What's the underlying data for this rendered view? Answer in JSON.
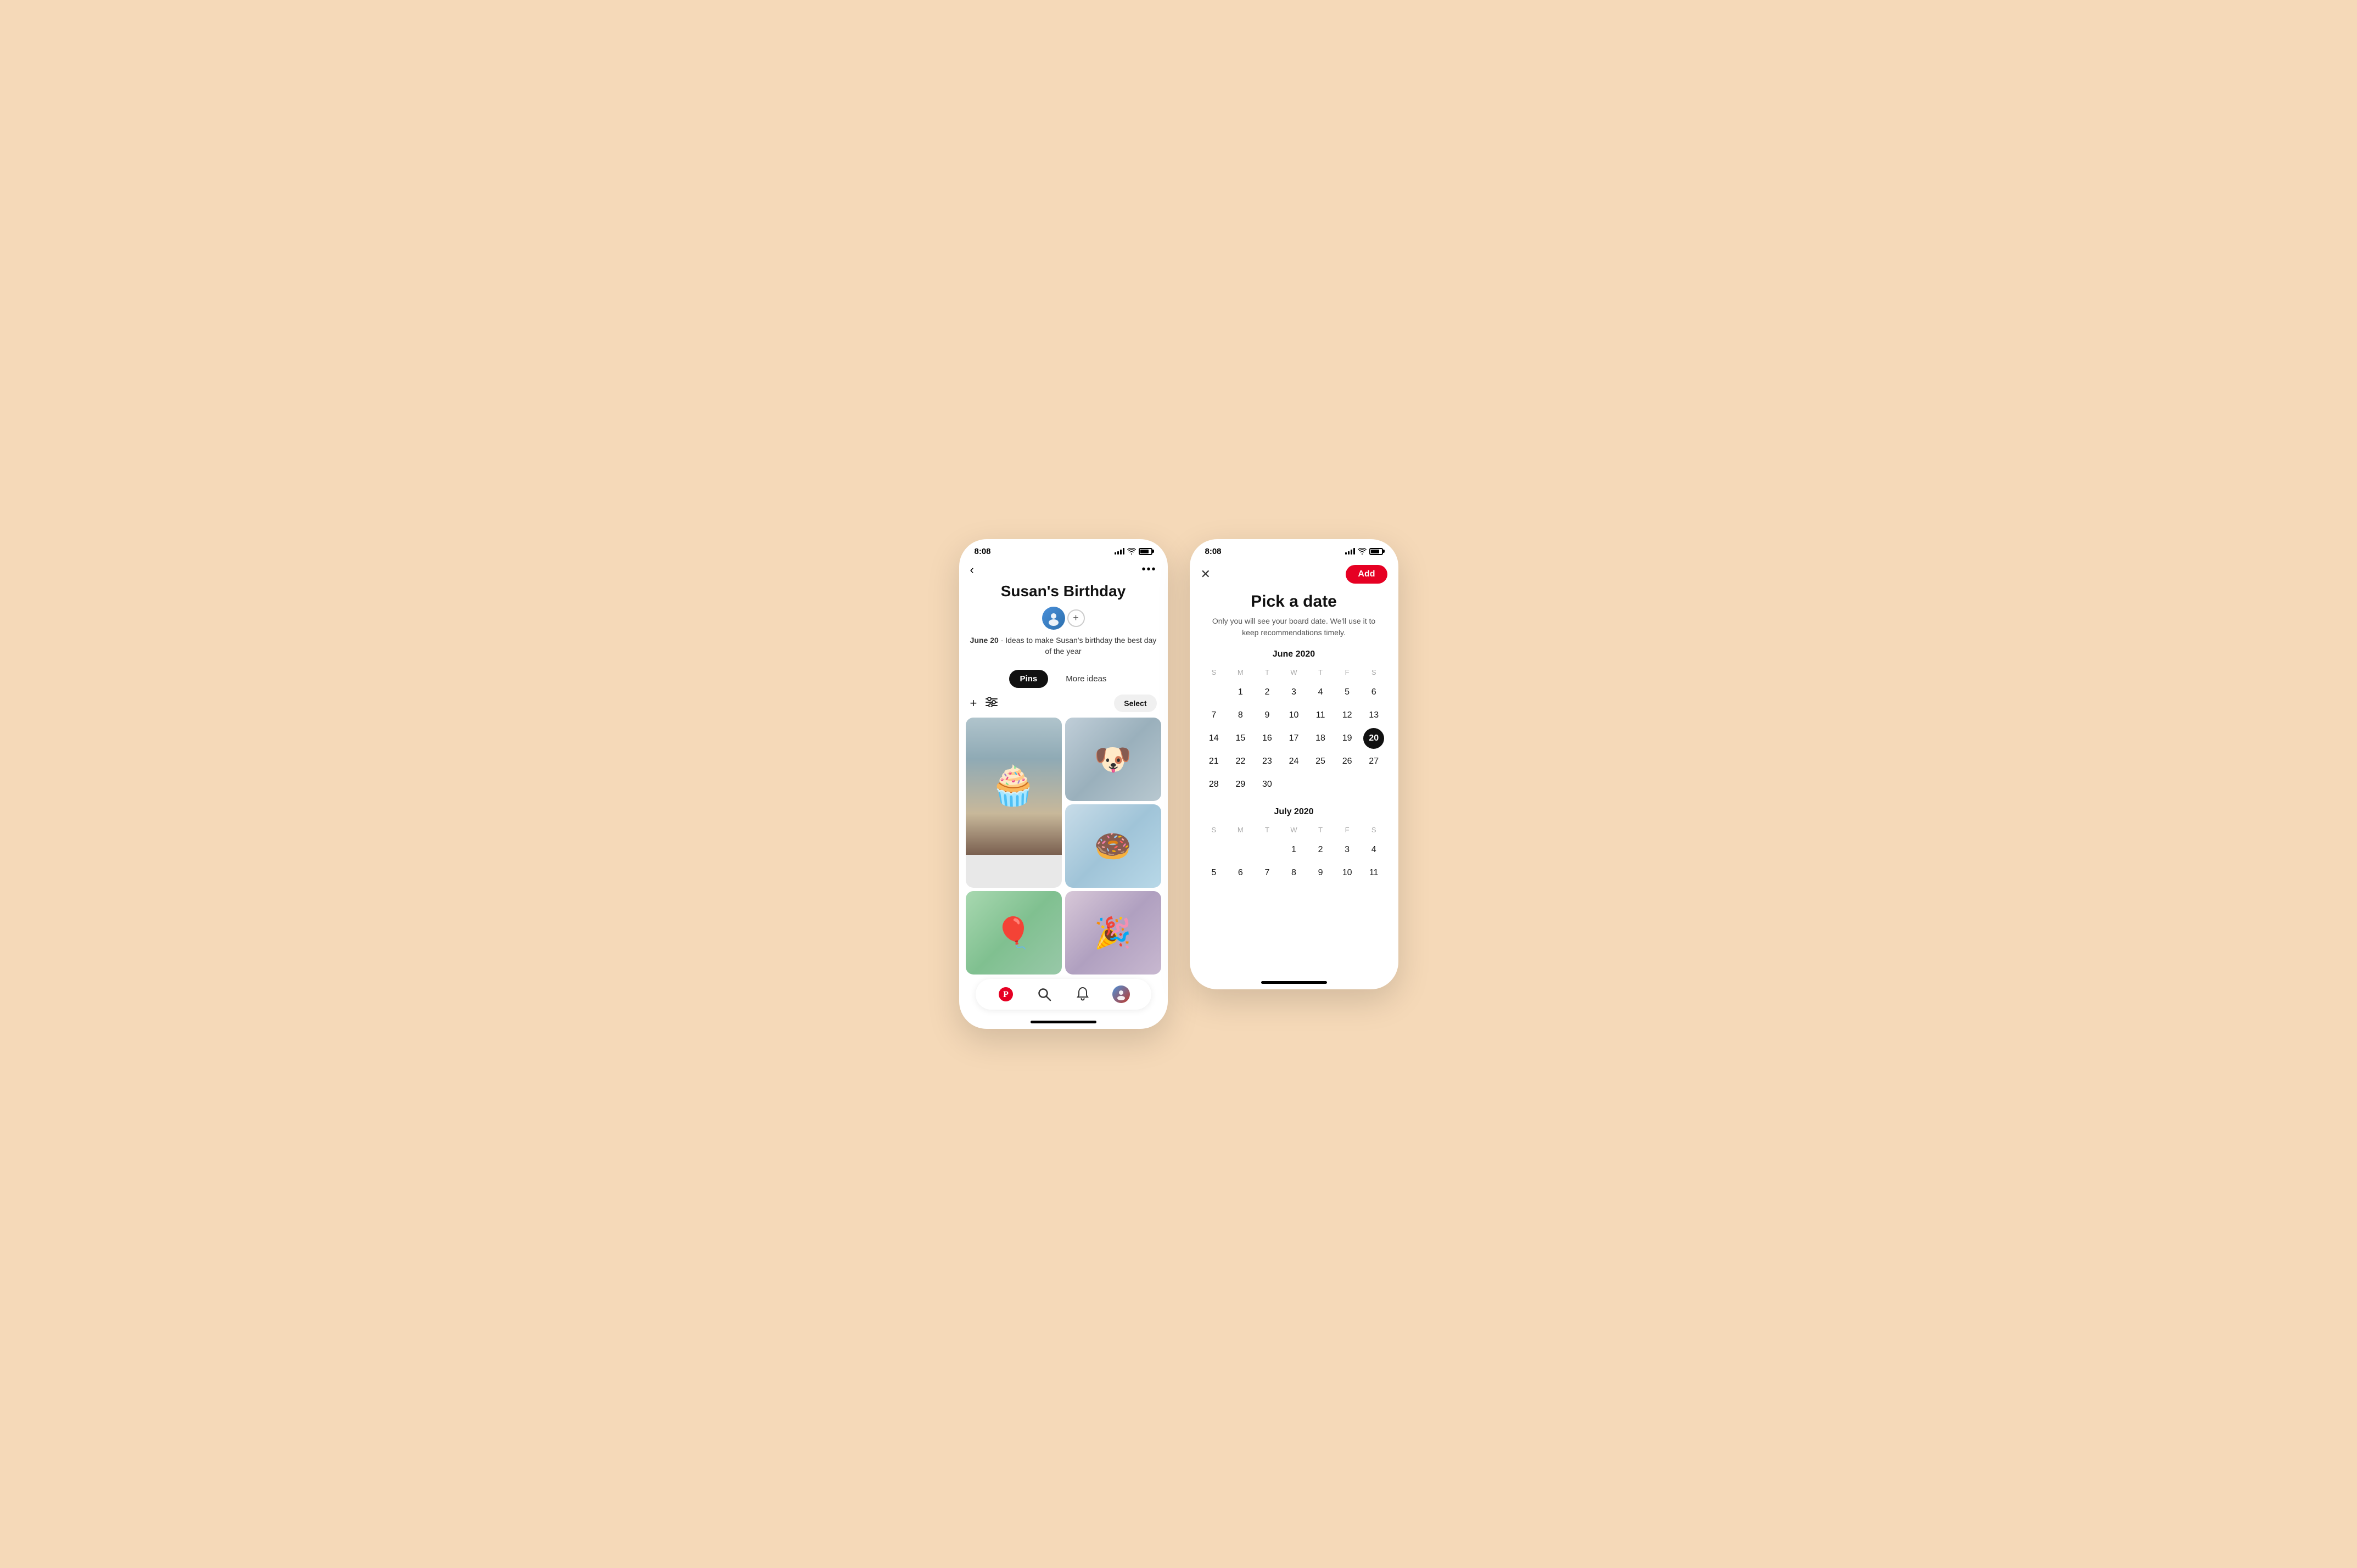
{
  "phone1": {
    "status_time": "8:08",
    "nav": {
      "back": "‹",
      "more": "•••"
    },
    "board": {
      "title": "Susan's Birthday",
      "desc_date": "June 20",
      "desc_text": " · Ideas to make Susan's birthday the best day of the year"
    },
    "tabs": [
      {
        "label": "Pins",
        "active": true
      },
      {
        "label": "More ideas",
        "active": false
      }
    ],
    "toolbar": {
      "plus": "+",
      "select_label": "Select"
    },
    "bottom_nav": [
      {
        "name": "home",
        "symbol": "P"
      },
      {
        "name": "search",
        "symbol": "🔍"
      },
      {
        "name": "bell",
        "symbol": "🔔"
      },
      {
        "name": "profile",
        "symbol": "👤"
      }
    ]
  },
  "phone2": {
    "status_time": "8:08",
    "close": "✕",
    "add_label": "Add",
    "title": "Pick a date",
    "subtitle": "Only you will see your board date. We'll use it to keep recommendations timely.",
    "calendar_june": {
      "month_label": "June 2020",
      "days_of_week": [
        "S",
        "M",
        "T",
        "W",
        "T",
        "F",
        "S"
      ],
      "weeks": [
        [
          "",
          "",
          "",
          "",
          "",
          "",
          ""
        ],
        [
          "1",
          "2",
          "3",
          "4",
          "5",
          "6",
          ""
        ],
        [
          "7",
          "8",
          "9",
          "10",
          "11",
          "12",
          "13"
        ],
        [
          "14",
          "15",
          "16",
          "17",
          "18",
          "19",
          "20"
        ],
        [
          "21",
          "22",
          "23",
          "24",
          "25",
          "26",
          "27"
        ],
        [
          "28",
          "29",
          "30",
          "",
          "",
          "",
          ""
        ]
      ],
      "selected_day": "20",
      "empty_start": 0
    },
    "calendar_july": {
      "month_label": "July 2020",
      "days_of_week": [
        "S",
        "M",
        "T",
        "W",
        "T",
        "F",
        "S"
      ],
      "weeks": [
        [
          "",
          "",
          "",
          "1",
          "2",
          "3",
          "4"
        ],
        [
          "5",
          "6",
          "7",
          "8",
          "9",
          "10",
          "11"
        ]
      ]
    }
  }
}
